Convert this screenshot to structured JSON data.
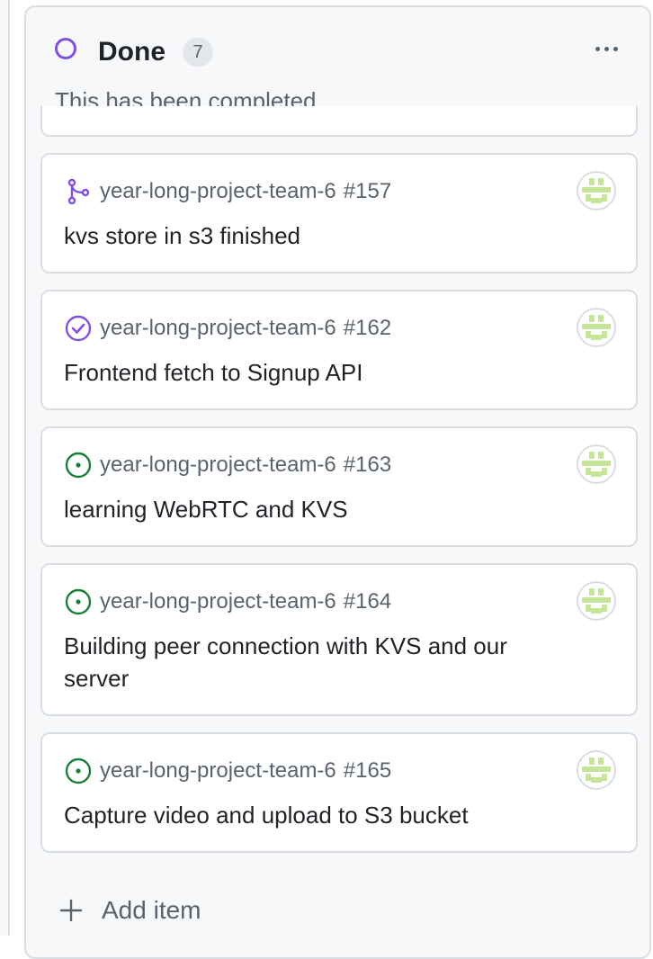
{
  "column": {
    "title": "Done",
    "count": "7",
    "description": "This has been completed",
    "status_color": "#8250df"
  },
  "cards": [
    {
      "type": "pull-request-merged",
      "icon": "git-merge-icon",
      "repo": "year-long-project-team-6",
      "number": "#157",
      "title": "kvs store in s3 finished",
      "icon_color": "#8250df"
    },
    {
      "type": "issue-closed",
      "icon": "issue-closed-icon",
      "repo": "year-long-project-team-6",
      "number": "#162",
      "title": "Frontend fetch to Signup API",
      "icon_color": "#8250df"
    },
    {
      "type": "issue-open",
      "icon": "issue-open-icon",
      "repo": "year-long-project-team-6",
      "number": "#163",
      "title": "learning WebRTC and KVS",
      "icon_color": "#1a7f37"
    },
    {
      "type": "issue-open",
      "icon": "issue-open-icon",
      "repo": "year-long-project-team-6",
      "number": "#164",
      "title": "Building peer connection with KVS and our server",
      "icon_color": "#1a7f37"
    },
    {
      "type": "issue-open",
      "icon": "issue-open-icon",
      "repo": "year-long-project-team-6",
      "number": "#165",
      "title": "Capture video and upload to S3 bucket",
      "icon_color": "#1a7f37"
    }
  ],
  "add_item": {
    "label": "Add item"
  },
  "colors": {
    "avatar_green": "#c7e59a",
    "muted_text": "#59636e",
    "border": "#d8dee4"
  }
}
